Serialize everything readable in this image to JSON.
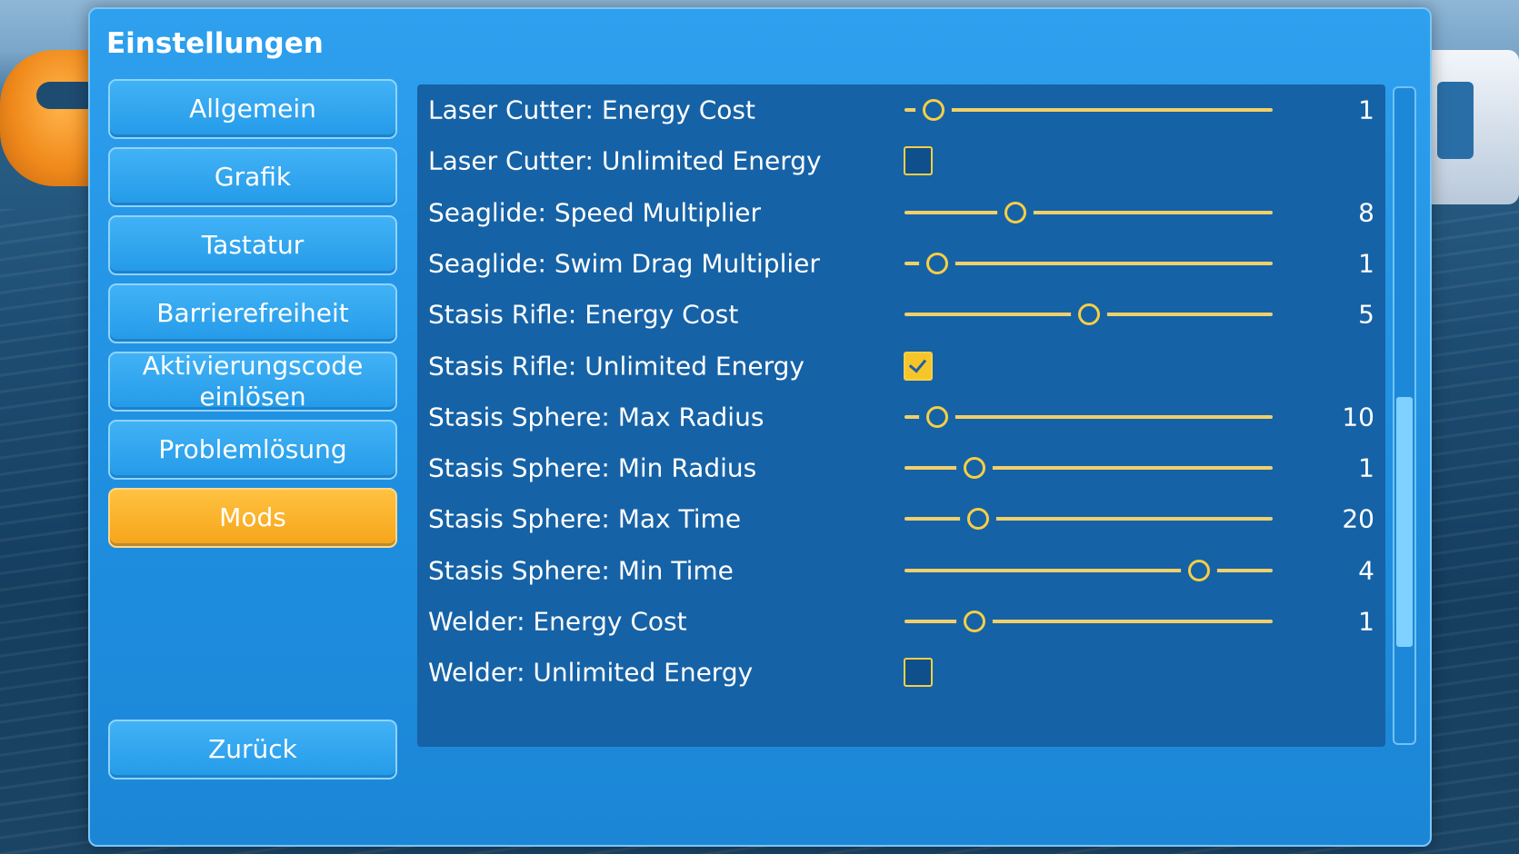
{
  "title": "Einstellungen",
  "nav": [
    {
      "label": "Allgemein",
      "active": false
    },
    {
      "label": "Grafik",
      "active": false
    },
    {
      "label": "Tastatur",
      "active": false
    },
    {
      "label": "Barrierefreiheit",
      "active": false
    },
    {
      "label": "Aktivierungscode einlösen",
      "active": false
    },
    {
      "label": "Problemlösung",
      "active": false
    },
    {
      "label": "Mods",
      "active": true
    }
  ],
  "back_label": "Zurück",
  "options": [
    {
      "label": "Laser Cutter: Energy Cost",
      "type": "slider",
      "value": "1",
      "position": 0.08
    },
    {
      "label": "Laser Cutter: Unlimited Energy",
      "type": "checkbox",
      "checked": false
    },
    {
      "label": "Seaglide: Speed Multiplier",
      "type": "slider",
      "value": "8",
      "position": 0.3
    },
    {
      "label": "Seaglide: Swim Drag Multiplier",
      "type": "slider",
      "value": "1",
      "position": 0.09
    },
    {
      "label": "Stasis Rifle: Energy Cost",
      "type": "slider",
      "value": "5",
      "position": 0.5
    },
    {
      "label": "Stasis Rifle: Unlimited Energy",
      "type": "checkbox",
      "checked": true
    },
    {
      "label": "Stasis Sphere: Max Radius",
      "type": "slider",
      "value": "10",
      "position": 0.09
    },
    {
      "label": "Stasis Sphere: Min Radius",
      "type": "slider",
      "value": "1",
      "position": 0.19
    },
    {
      "label": "Stasis Sphere: Max Time",
      "type": "slider",
      "value": "20",
      "position": 0.2
    },
    {
      "label": "Stasis Sphere: Min Time",
      "type": "slider",
      "value": "4",
      "position": 0.8
    },
    {
      "label": "Welder: Energy Cost",
      "type": "slider",
      "value": "1",
      "position": 0.19
    },
    {
      "label": "Welder: Unlimited Energy",
      "type": "checkbox",
      "checked": false
    }
  ],
  "colors": {
    "panel": "#1f8fe0",
    "list_bg": "#1662a6",
    "accent": "#f6cf45",
    "active_tab": "#f6a41a"
  }
}
